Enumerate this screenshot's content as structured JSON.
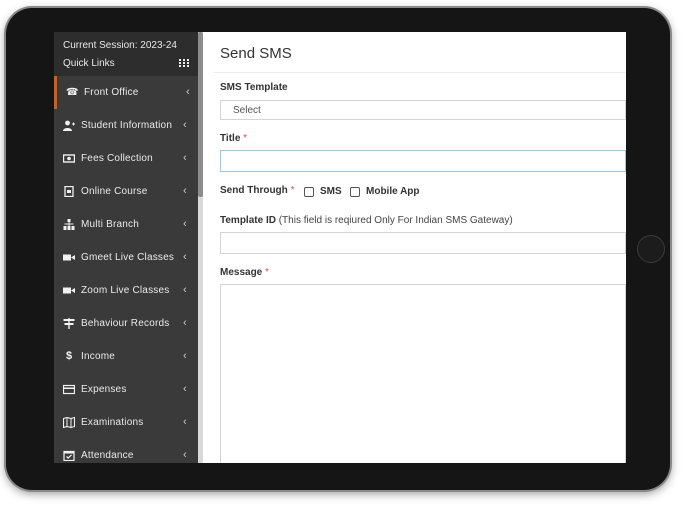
{
  "sidebar": {
    "session": "Current Session: 2023-24",
    "quick_links": "Quick Links",
    "items": [
      {
        "label": "Front Office",
        "icon": "front-office-icon"
      },
      {
        "label": "Student Information",
        "icon": "user-plus-icon"
      },
      {
        "label": "Fees Collection",
        "icon": "money-icon"
      },
      {
        "label": "Online Course",
        "icon": "document-icon"
      },
      {
        "label": "Multi Branch",
        "icon": "sitemap-icon"
      },
      {
        "label": "Gmeet Live Classes",
        "icon": "video-icon"
      },
      {
        "label": "Zoom Live Classes",
        "icon": "video-icon"
      },
      {
        "label": "Behaviour Records",
        "icon": "sign-icon"
      },
      {
        "label": "Income",
        "icon": "dollar-icon"
      },
      {
        "label": "Expenses",
        "icon": "credit-card-icon"
      },
      {
        "label": "Examinations",
        "icon": "map-icon"
      },
      {
        "label": "Attendance",
        "icon": "calendar-check-icon"
      }
    ]
  },
  "form": {
    "title": "Send SMS",
    "sms_template_label": "SMS Template",
    "sms_template_value": "Select",
    "title_label": "Title",
    "required_mark": "*",
    "send_through_label": "Send Through",
    "option_sms": "SMS",
    "option_mobile_app": "Mobile App",
    "template_id_label": "Template ID",
    "template_id_note": "(This field is reqiured Only For Indian SMS Gateway)",
    "message_label": "Message"
  },
  "colors": {
    "sidebar_bg": "#3a3a3a",
    "sidebar_header_bg": "#2d2d2d",
    "active_accent": "#c0622b",
    "required": "#d9534f"
  }
}
